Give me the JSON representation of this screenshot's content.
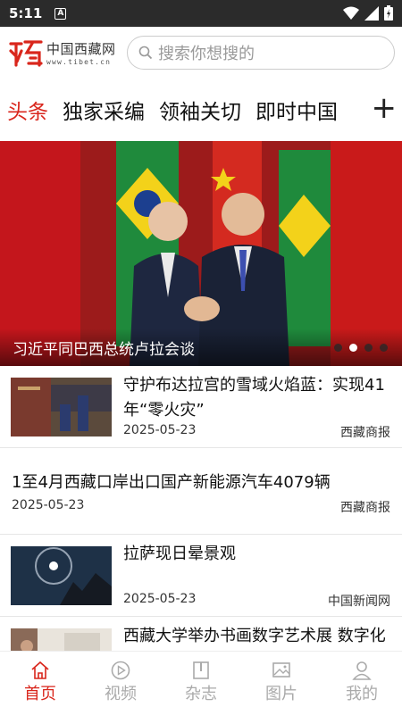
{
  "status_bar": {
    "time": "5:11",
    "notification_badge": "A"
  },
  "header": {
    "logo_cn": "中国西藏网",
    "logo_url": "www.tibet.cn",
    "search_placeholder": "搜索你想搜的"
  },
  "tabs": [
    {
      "label": "头条",
      "active": true
    },
    {
      "label": "独家采编"
    },
    {
      "label": "领袖关切"
    },
    {
      "label": "即时中国"
    }
  ],
  "tab_add_label": "+",
  "banner": {
    "caption": "习近平同巴西总统卢拉会谈",
    "slide_count": 4,
    "active_slide": 2
  },
  "news": [
    {
      "kind": "image",
      "title": "守护布达拉宫的雪域火焰蓝：实现41年“零火灾”",
      "date": "2025-05-23",
      "source": "西藏商报"
    },
    {
      "kind": "text",
      "title": "1至4月西藏口岸出口国产新能源汽车4079辆",
      "date": "2025-05-23",
      "source": "西藏商报"
    },
    {
      "kind": "image",
      "title": "拉萨现日晕景观",
      "date": "2025-05-23",
      "source": "中国新闻网"
    },
    {
      "kind": "image",
      "title": "西藏大学举办书画数字艺术展 数字化技术展现中华优秀传统",
      "date": "",
      "source": ""
    }
  ],
  "bottom_nav": [
    {
      "label": "首页",
      "icon": "home-icon",
      "active": true
    },
    {
      "label": "视频",
      "icon": "play-icon"
    },
    {
      "label": "杂志",
      "icon": "magazine-icon"
    },
    {
      "label": "图片",
      "icon": "image-icon"
    },
    {
      "label": "我的",
      "icon": "person-icon"
    }
  ],
  "colors": {
    "accent": "#d9261c",
    "status_bar": "#2b2b2b"
  }
}
